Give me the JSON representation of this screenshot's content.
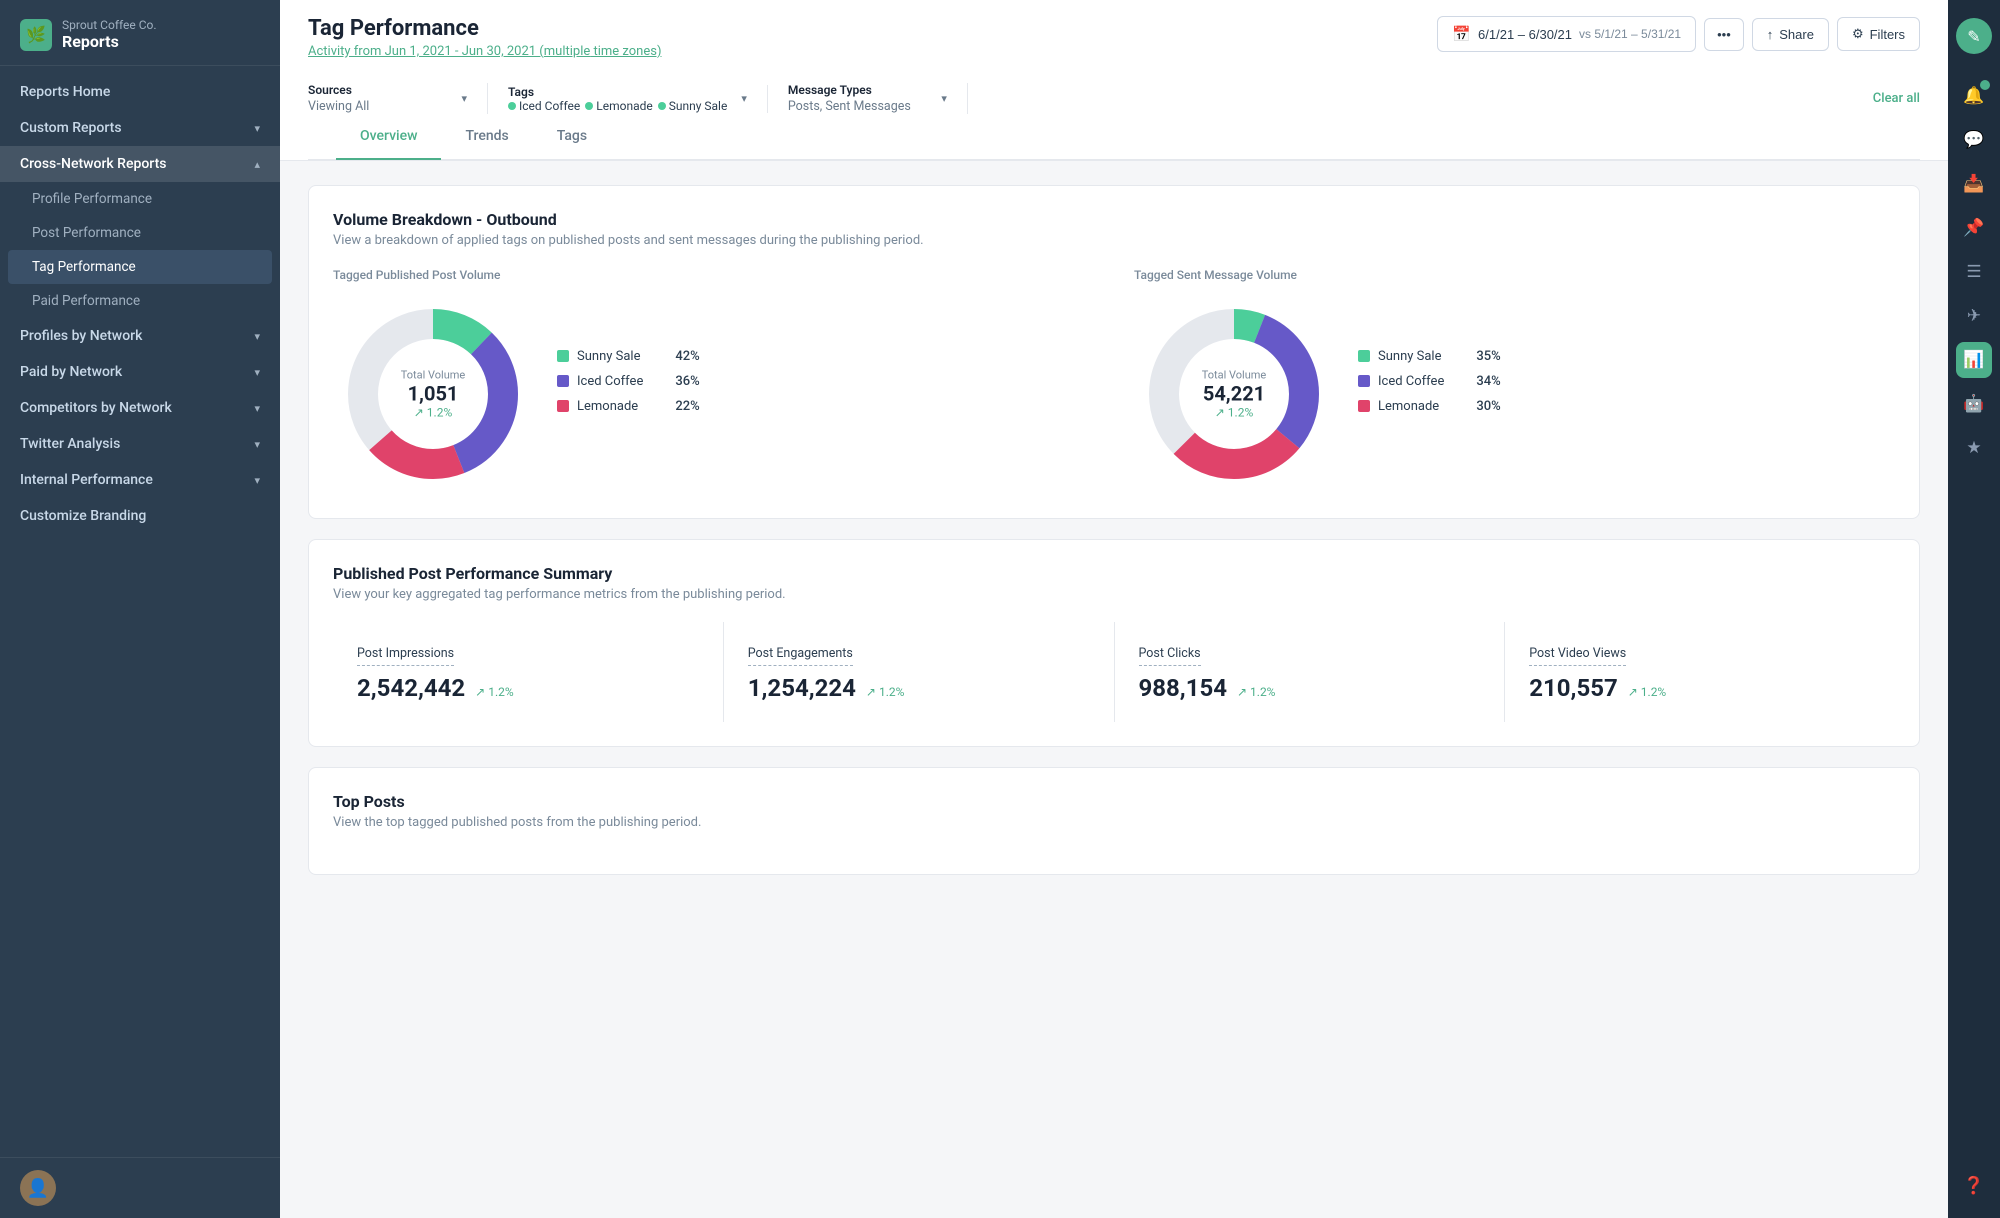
{
  "brand": {
    "company": "Sprout Coffee Co.",
    "section": "Reports"
  },
  "sidebar": {
    "nav_items": [
      {
        "label": "Reports Home",
        "type": "top",
        "chevron": false
      },
      {
        "label": "Custom Reports",
        "type": "top",
        "chevron": true
      },
      {
        "label": "Cross-Network Reports",
        "type": "section",
        "chevron": true,
        "expanded": true
      },
      {
        "label": "Profile Performance",
        "type": "sub"
      },
      {
        "label": "Post Performance",
        "type": "sub"
      },
      {
        "label": "Tag Performance",
        "type": "sub",
        "active": true
      },
      {
        "label": "Paid Performance",
        "type": "sub"
      },
      {
        "label": "Profiles by Network",
        "type": "top",
        "chevron": true
      },
      {
        "label": "Paid by Network",
        "type": "top",
        "chevron": true
      },
      {
        "label": "Competitors by Network",
        "type": "top",
        "chevron": true
      },
      {
        "label": "Twitter Analysis",
        "type": "top",
        "chevron": true
      },
      {
        "label": "Internal Performance",
        "type": "top",
        "chevron": true
      },
      {
        "label": "Customize Branding",
        "type": "top",
        "chevron": false
      }
    ]
  },
  "header": {
    "title": "Tag Performance",
    "subtitle": "Activity from Jun 1, 2021 - Jun 30, 2021",
    "subtitle_link": "multiple",
    "subtitle_suffix": "time zones)",
    "date_range": "6/1/21 – 6/30/21",
    "vs_range": "vs 5/1/21 – 5/31/21",
    "share_label": "Share",
    "filter_label": "Filters"
  },
  "filters": {
    "sources_label": "Sources",
    "sources_value": "Viewing All",
    "tags_label": "Tags",
    "tags": [
      {
        "name": "Iced Coffee",
        "color": "#4caf8a"
      },
      {
        "name": "Lemonade",
        "color": "#4caf8a"
      },
      {
        "name": "Sunny Sale",
        "color": "#4caf8a"
      }
    ],
    "message_types_label": "Message Types",
    "message_types_value": "Posts, Sent Messages",
    "clear_all": "Clear all"
  },
  "tabs": [
    {
      "label": "Overview",
      "active": true
    },
    {
      "label": "Trends",
      "active": false
    },
    {
      "label": "Tags",
      "active": false
    }
  ],
  "volume_section": {
    "title": "Volume Breakdown - Outbound",
    "subtitle": "View a breakdown of applied tags on published posts and sent messages during the publishing period.",
    "left_chart": {
      "label": "Tagged Published Post Volume",
      "center_label": "Total Volume",
      "center_value": "1,051",
      "center_change": "↗ 1.2%",
      "segments": [
        {
          "name": "Sunny Sale",
          "pct": 42,
          "color": "#4cce9a",
          "startAngle": 0,
          "sweep": 151.2
        },
        {
          "name": "Iced Coffee",
          "pct": 36,
          "color": "#6659c8",
          "startAngle": 151.2,
          "sweep": 129.6
        },
        {
          "name": "Lemonade",
          "pct": 22,
          "color": "#e0436a",
          "startAngle": 280.8,
          "sweep": 79.2
        }
      ]
    },
    "right_chart": {
      "label": "Tagged Sent Message Volume",
      "center_label": "Total Volume",
      "center_value": "54,221",
      "center_change": "↗ 1.2%",
      "segments": [
        {
          "name": "Sunny Sale",
          "pct": 35,
          "color": "#4cce9a",
          "startAngle": 0,
          "sweep": 126
        },
        {
          "name": "Iced Coffee",
          "pct": 34,
          "color": "#6659c8",
          "startAngle": 126,
          "sweep": 122.4
        },
        {
          "name": "Lemonade",
          "pct": 30,
          "color": "#e0436a",
          "startAngle": 248.4,
          "sweep": 108
        }
      ]
    }
  },
  "performance_section": {
    "title": "Published Post Performance Summary",
    "subtitle": "View your key aggregated tag performance metrics from the publishing period.",
    "metrics": [
      {
        "label": "Post Impressions",
        "value": "2,542,442",
        "change": "↗ 1.2%"
      },
      {
        "label": "Post Engagements",
        "value": "1,254,224",
        "change": "↗ 1.2%"
      },
      {
        "label": "Post Clicks",
        "value": "988,154",
        "change": "↗ 1.2%"
      },
      {
        "label": "Post Video Views",
        "value": "210,557",
        "change": "↗ 1.2%"
      }
    ]
  },
  "top_posts_section": {
    "title": "Top Posts",
    "subtitle": "View the top tagged published posts from the publishing period."
  },
  "rail_icons": [
    {
      "icon": "✎",
      "label": "compose-icon",
      "active": false,
      "badge": false
    },
    {
      "icon": "🔔",
      "label": "notifications-icon",
      "active": false,
      "badge": true
    },
    {
      "icon": "💬",
      "label": "messages-icon",
      "active": false,
      "badge": false
    },
    {
      "icon": "📥",
      "label": "inbox-icon",
      "active": false,
      "badge": false
    },
    {
      "icon": "📌",
      "label": "tasks-icon",
      "active": false,
      "badge": false
    },
    {
      "icon": "☰",
      "label": "calendar-icon",
      "active": false,
      "badge": false
    },
    {
      "icon": "✈",
      "label": "publish-icon",
      "active": false,
      "badge": false
    },
    {
      "icon": "📊",
      "label": "analytics-icon",
      "active": true,
      "badge": false
    },
    {
      "icon": "🤖",
      "label": "automation-icon",
      "active": false,
      "badge": false
    },
    {
      "icon": "★",
      "label": "reviews-icon",
      "active": false,
      "badge": false
    },
    {
      "icon": "❓",
      "label": "help-icon",
      "active": false,
      "badge": false
    }
  ]
}
